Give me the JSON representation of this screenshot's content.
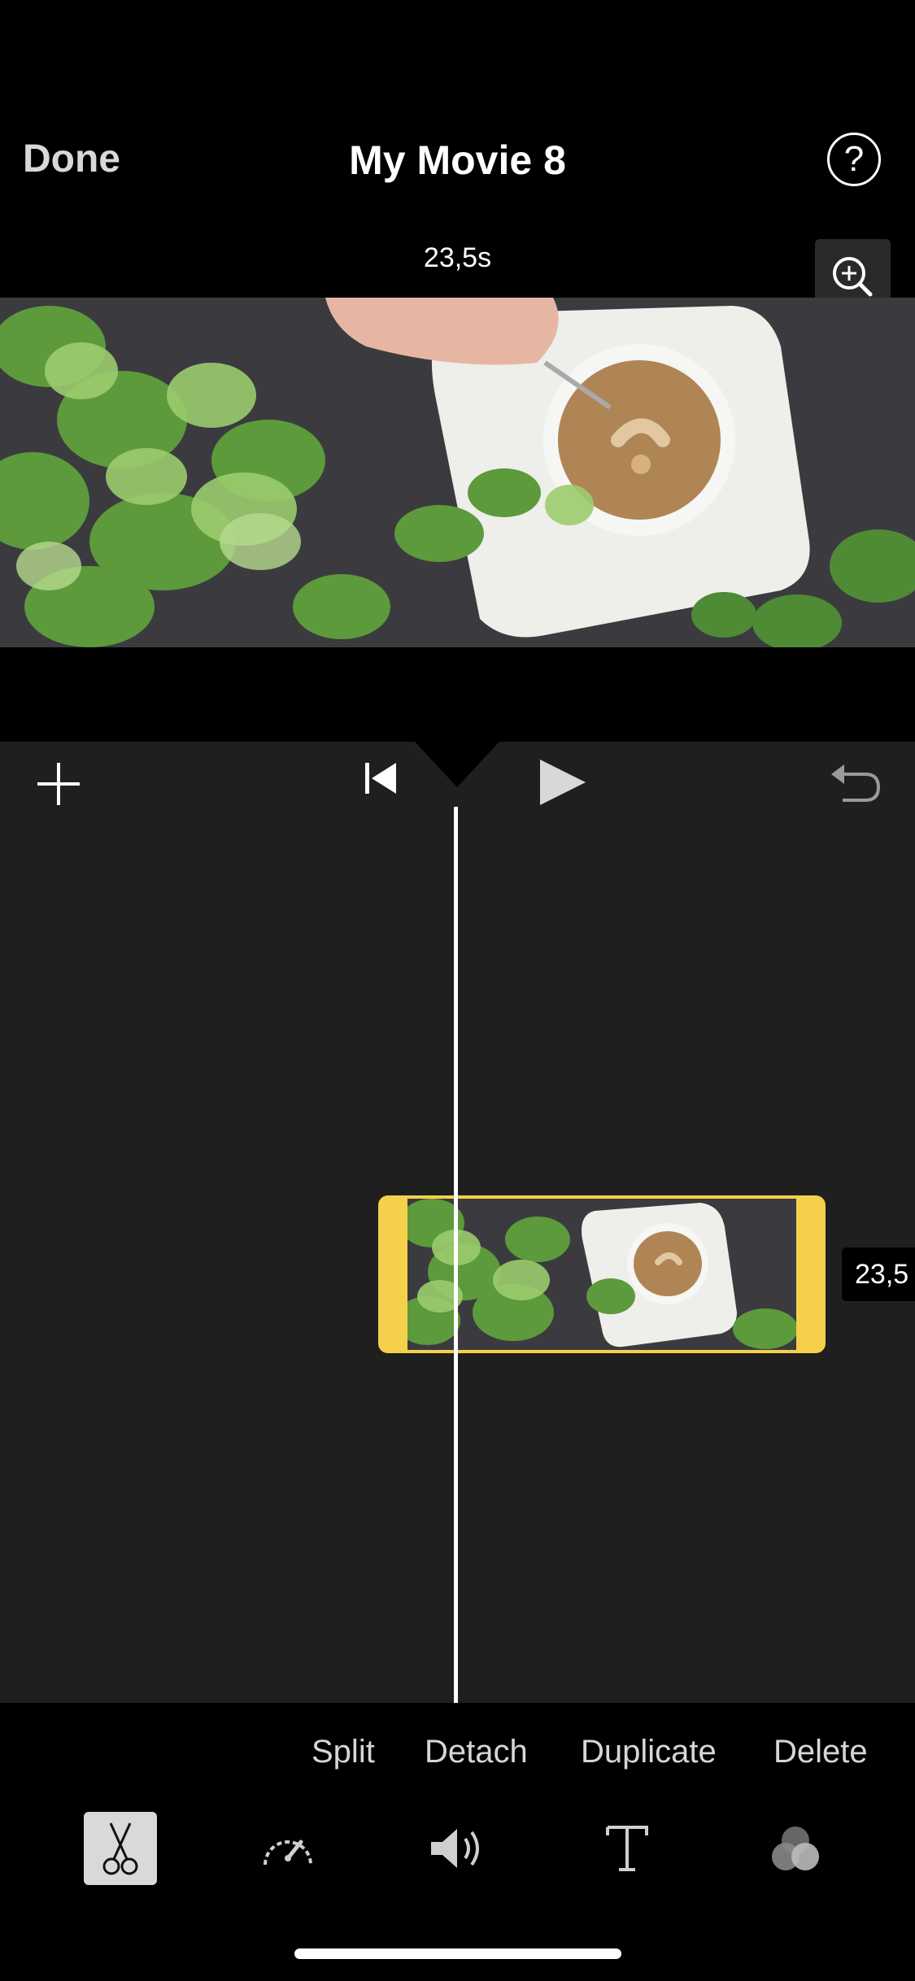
{
  "header": {
    "done_label": "Done",
    "title": "My Movie 8",
    "help_glyph": "?",
    "duration": "23,5s"
  },
  "icons": {
    "zoom": "zoom-in-icon",
    "add": "plus-icon",
    "skip_start": "skip-to-start-icon",
    "play": "play-icon",
    "undo": "undo-icon",
    "scissors": "scissors-icon",
    "speed": "speedometer-icon",
    "volume": "volume-icon",
    "text": "text-icon",
    "filters": "filters-icon"
  },
  "clip": {
    "duration_label": "23,5"
  },
  "actions": {
    "split": "Split",
    "detach": "Detach",
    "duplicate": "Duplicate",
    "delete": "Delete"
  },
  "colors": {
    "clip_border": "#f5d04b",
    "timeline_bg": "#1f1f1f",
    "background": "#000000"
  }
}
